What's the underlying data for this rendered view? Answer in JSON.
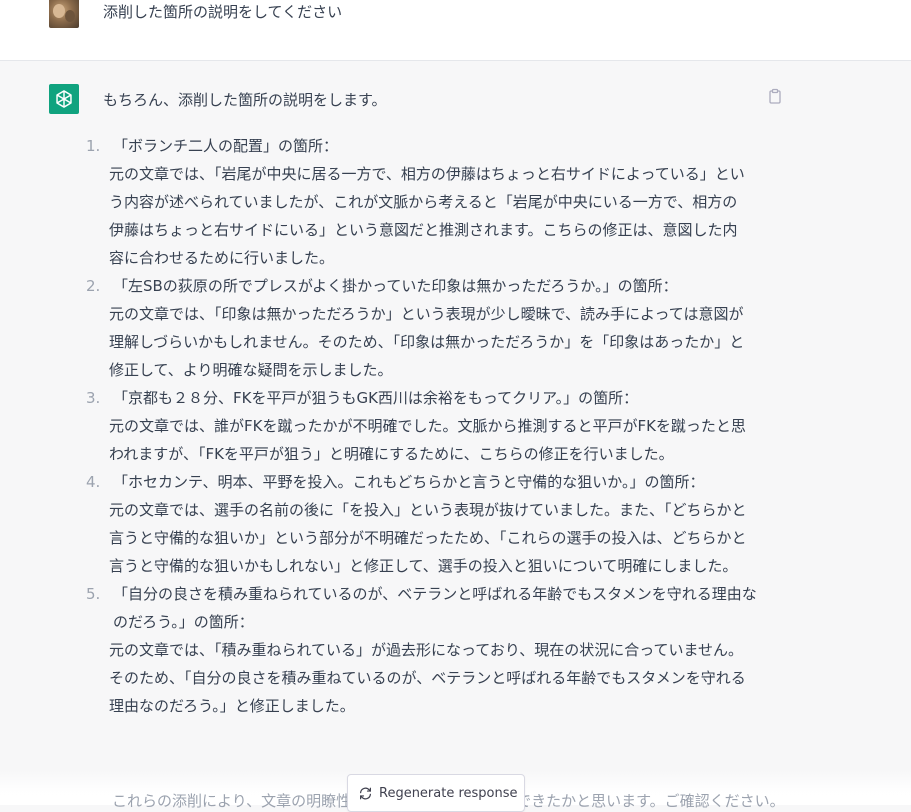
{
  "user_message": "添削した箇所の説明をしてください",
  "assistant": {
    "intro": "もちろん、添削した箇所の説明をします。",
    "items": [
      {
        "num": "1.",
        "title": "「ボランチ二人の配置」の箇所：",
        "body": "元の文章では、「岩尾が中央に居る一方で、相方の伊藤はちょっと右サイドによっている」という内容が述べられていましたが、これが文脈から考えると「岩尾が中央にいる一方で、相方の伊藤はちょっと右サイドにいる」という意図だと推測されます。こちらの修正は、意図した内容に合わせるために行いました。"
      },
      {
        "num": "2.",
        "title": "「左SBの荻原の所でプレスがよく掛かっていた印象は無かっただろうか。」の箇所：",
        "body": "元の文章では、「印象は無かっただろうか」という表現が少し曖昧で、読み手によっては意図が理解しづらいかもしれません。そのため、「印象は無かっただろうか」を「印象はあったか」と修正して、より明確な疑問を示しました。"
      },
      {
        "num": "3.",
        "title": "「京都も２８分、FKを平戸が狙うもGK西川は余裕をもってクリア。」の箇所：",
        "body": "元の文章では、誰がFKを蹴ったかが不明確でした。文脈から推測すると平戸がFKを蹴ったと思われますが、「FKを平戸が狙う」と明確にするために、こちらの修正を行いました。"
      },
      {
        "num": "4.",
        "title": "「ホセカンテ、明本、平野を投入。これもどちらかと言うと守備的な狙いか。」の箇所：",
        "body": "元の文章では、選手の名前の後に「を投入」という表現が抜けていました。また、「どちらかと言うと守備的な狙いか」という部分が不明確だったため、「これらの選手の投入は、どちらかと言うと守備的な狙いかもしれない」と修正して、選手の投入と狙いについて明確にしました。"
      },
      {
        "num": "5.",
        "title": "「自分の良さを積み重ねられているのが、ベテランと呼ばれる年齢でもスタメンを守れる理由なのだろう。」の箇所：",
        "body": "元の文章では、「積み重ねられている」が過去形になっており、現在の状況に合っていません。そのため、「自分の良さを積み重ねているのが、ベテランと呼ばれる年齢でもスタメンを守れる理由なのだろう。」と修正しました。"
      }
    ],
    "trailing": "これらの添削により、文章の明瞭性や正確性を高めることができたかと思います。ご確認ください。"
  },
  "regenerate_label": "Regenerate response",
  "icons": {
    "user_avatar": "user-avatar-photo",
    "assistant_avatar": "openai-logo-icon",
    "copy": "clipboard-icon",
    "regenerate": "refresh-icon"
  },
  "colors": {
    "assistant_avatar_bg": "#10a37f",
    "page_bg": "#f7f7f8",
    "user_row_bg": "#ffffff"
  }
}
